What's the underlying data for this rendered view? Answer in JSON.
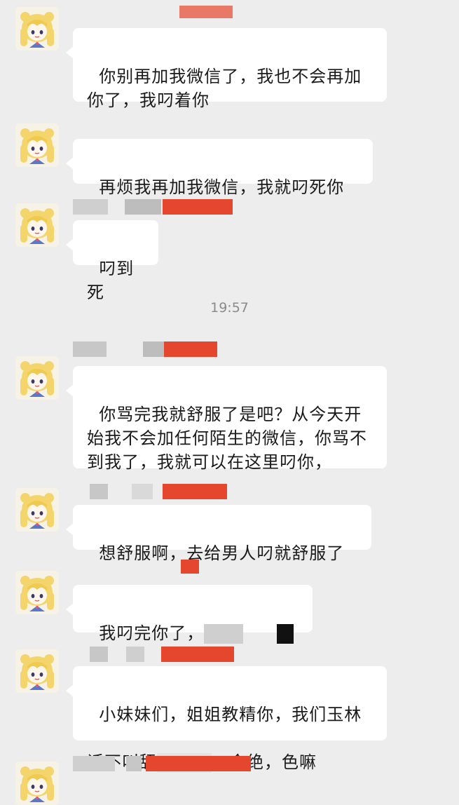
{
  "messages": [
    {
      "text": "你别再加我微信了，我也不会再加你了，我叼着你"
    },
    {
      "text": "再烦我再加我微信，我就叼死你"
    },
    {
      "text": "叼到死"
    },
    {
      "text": "你骂完我就舒服了是吧？从今天开始我不会加任何陌生的微信，你骂不到我了，我就可以在这里叼你，"
    },
    {
      "text": "想舒服啊，去给男人叼就舒服了"
    },
    {
      "text_prefix": "我叼完你了，"
    },
    {
      "text_line1": "小妹妹们，姐姐教精你，我们玉林",
      "text_line2_prefix": "话不叫舔",
      "text_line2_suffix": "，含绝，色嘛"
    }
  ],
  "timestamp": "19:57",
  "colors": {
    "background": "#ededed",
    "bubble": "#ffffff",
    "redaction_red": "#e4472e",
    "redaction_gray": "#bdbdbd"
  },
  "icons": {
    "avatar": "sailor-moon-cartoon-avatar"
  }
}
